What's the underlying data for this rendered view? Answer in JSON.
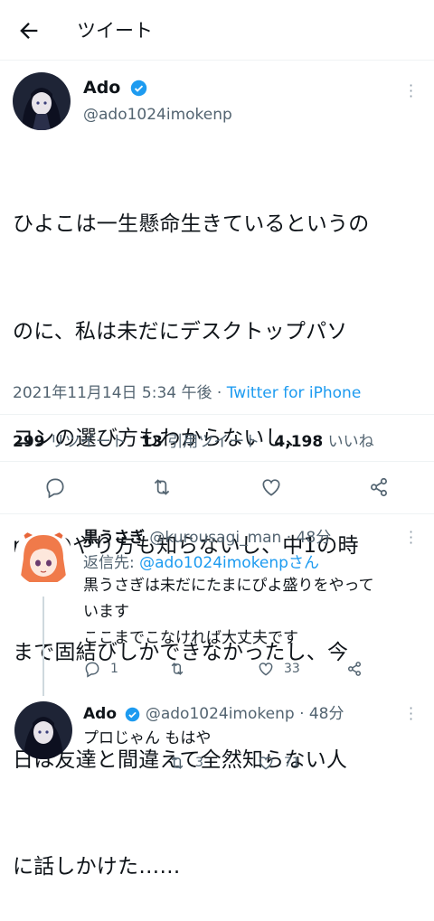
{
  "header": {
    "title": "ツイート"
  },
  "tweet": {
    "name": "Ado",
    "handle": "@ado1024imokenp",
    "lines": [
      "ひよこは一生懸命生きているというの",
      "のに、私は未だにデスクトップパソ",
      "コンの選び方もわからないし、",
      "mixのやり方も知らないし、中1の時",
      "まで固結びしかできなかったし、今",
      "日は友達と間違えて全然知らない人",
      "に話しかけた……"
    ],
    "timestamp": "2021年11月14日 5:34 午後",
    "source": "Twitter for iPhone",
    "retweets": "299",
    "retweets_label": "リツイート",
    "quotes": "13",
    "quotes_label": "引用ツイート",
    "likes": "4,198",
    "likes_label": "いいね"
  },
  "reply1": {
    "name": "黒うさぎ",
    "handle": "@kurousagi_man",
    "time": "· 48分",
    "replying_prefix": "返信先:",
    "replying_to": "@ado1024imokenpさん",
    "line1": "黒うさぎは未だにたまにぴよ盛りをやって",
    "line2": "います",
    "line3": "ここまでこなければ大丈夫です",
    "reply_count": "1",
    "retweet_count": "",
    "like_count": "33"
  },
  "reply2": {
    "name": "Ado",
    "handle": "@ado1024imokenp",
    "time": "· 48分",
    "text": "プロじゃん もはや",
    "retweet_count": "3",
    "like_count": "71"
  },
  "colors": {
    "accent": "#1d9bf0",
    "muted": "#536471",
    "border": "#eff3f4"
  }
}
